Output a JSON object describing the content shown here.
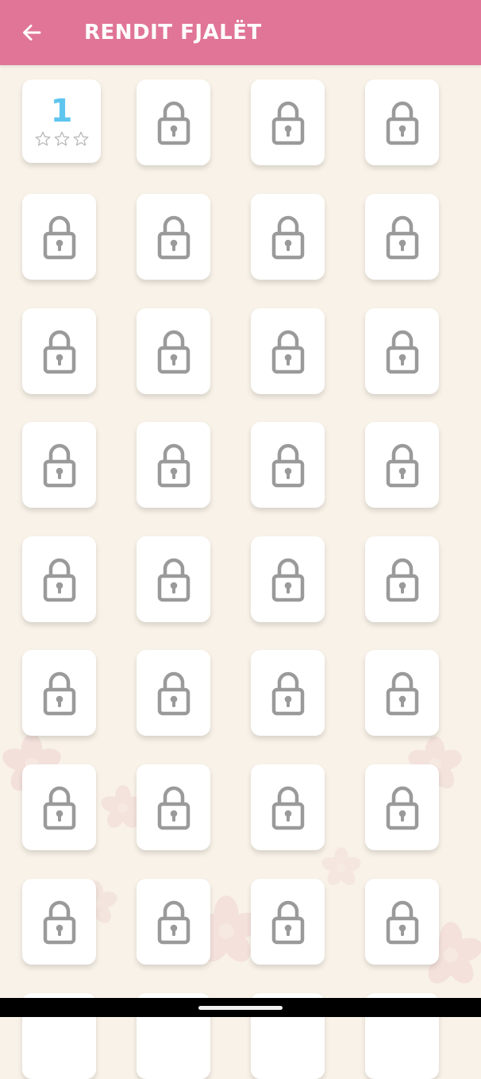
{
  "app_bar": {
    "title": "RENDIT FJALËT",
    "back_icon": "arrow-left-icon",
    "color": "#e07597"
  },
  "levels": {
    "first_level": {
      "number": "1",
      "stars_earned": 0,
      "stars_total": 3,
      "number_color": "#5ec5ef"
    },
    "locked_count": 31,
    "locked_icon": "lock-icon",
    "partially_visible_next_row": true
  },
  "colors": {
    "background": "#f8f2e8",
    "tile": "#ffffff",
    "lock": "#9a9a9a",
    "star_outline": "#b8b8b8"
  }
}
